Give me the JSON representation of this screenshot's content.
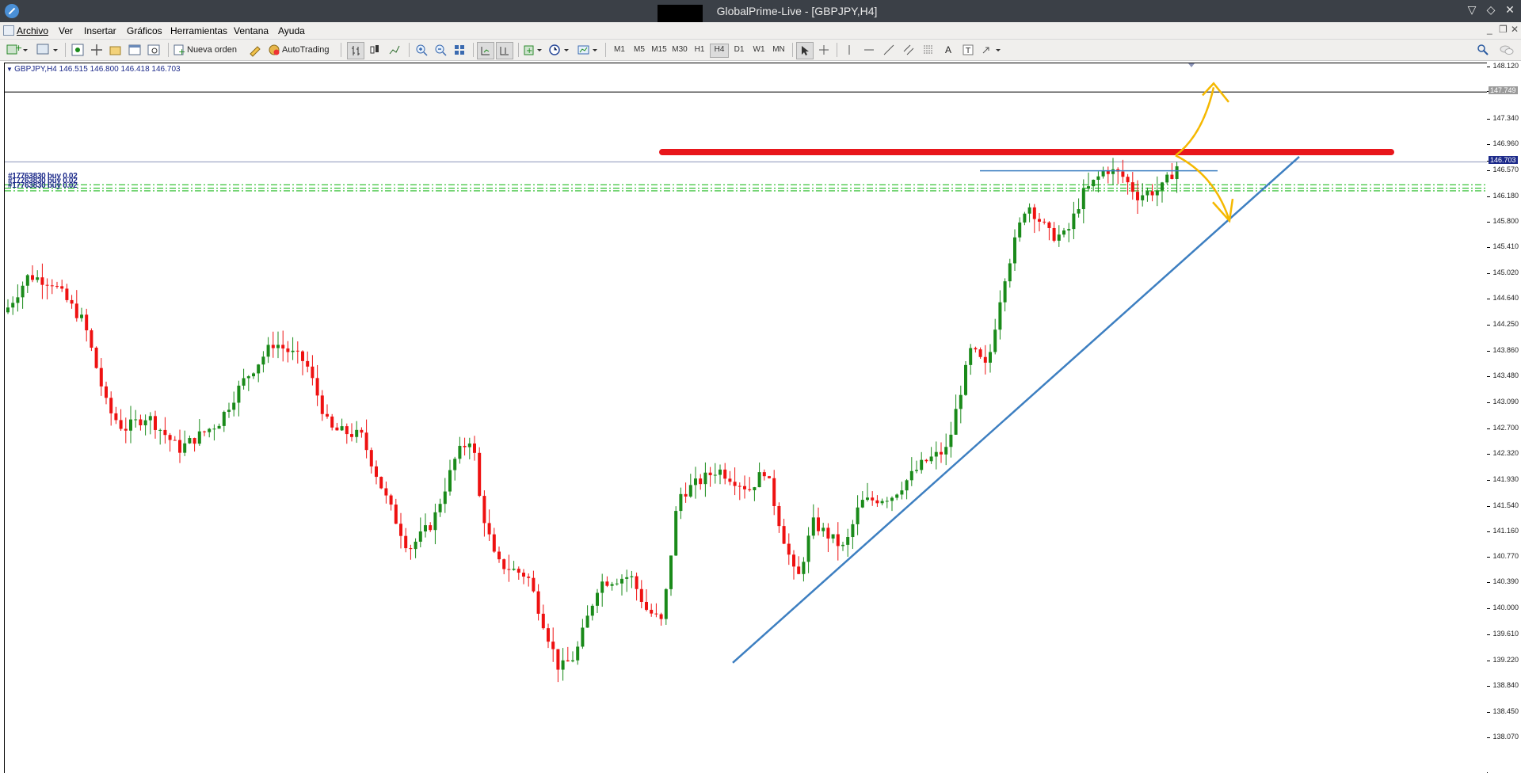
{
  "window": {
    "title": "GlobalPrime-Live - [GBPJPY,H4]",
    "controls": [
      "▽",
      "◇",
      "✕"
    ]
  },
  "menu": {
    "items": [
      "Archivo",
      "Ver",
      "Insertar",
      "Gráficos",
      "Herramientas",
      "Ventana",
      "Ayuda"
    ],
    "right_controls": [
      "_",
      "❐",
      "✕"
    ]
  },
  "toolbar": {
    "new_order_label": "Nueva orden",
    "autotrading_label": "AutoTrading",
    "timeframes": [
      "M1",
      "M5",
      "M15",
      "M30",
      "H1",
      "H4",
      "D1",
      "W1",
      "MN"
    ],
    "active_timeframe": "H4"
  },
  "symbol_info": {
    "text": "GBPJPY,H4  146.515 146.800 146.418 146.703"
  },
  "trade_labels": {
    "text": "#17763830 buy 0.02"
  },
  "price_axis": {
    "labels": [
      "148.120",
      "147.749",
      "147.340",
      "146.960",
      "146.703",
      "146.570",
      "146.180",
      "145.800",
      "145.410",
      "145.020",
      "144.640",
      "144.250",
      "143.860",
      "143.480",
      "143.090",
      "142.700",
      "142.320",
      "141.930",
      "141.540",
      "141.160",
      "140.770",
      "140.390",
      "140.000",
      "139.610",
      "139.220",
      "138.840",
      "138.450",
      "138.070"
    ],
    "current_price": "146.703",
    "horizontal_line_price": "147.749"
  },
  "chart_data": {
    "type": "candlestick",
    "symbol": "GBPJPY",
    "timeframe": "H4",
    "current": {
      "open": 146.515,
      "high": 146.8,
      "low": 146.418,
      "close": 146.703
    },
    "ylim": [
      137.75,
      148.25
    ],
    "resistance_level": 146.85,
    "horizontal_line": 147.749,
    "colors": {
      "bull": "#1a8a1a",
      "bear": "#ee1111",
      "resistance": "#e8161b",
      "trendline": "#3d7fc1",
      "arrows": "#f5b800",
      "entries": "#22bb22"
    }
  }
}
